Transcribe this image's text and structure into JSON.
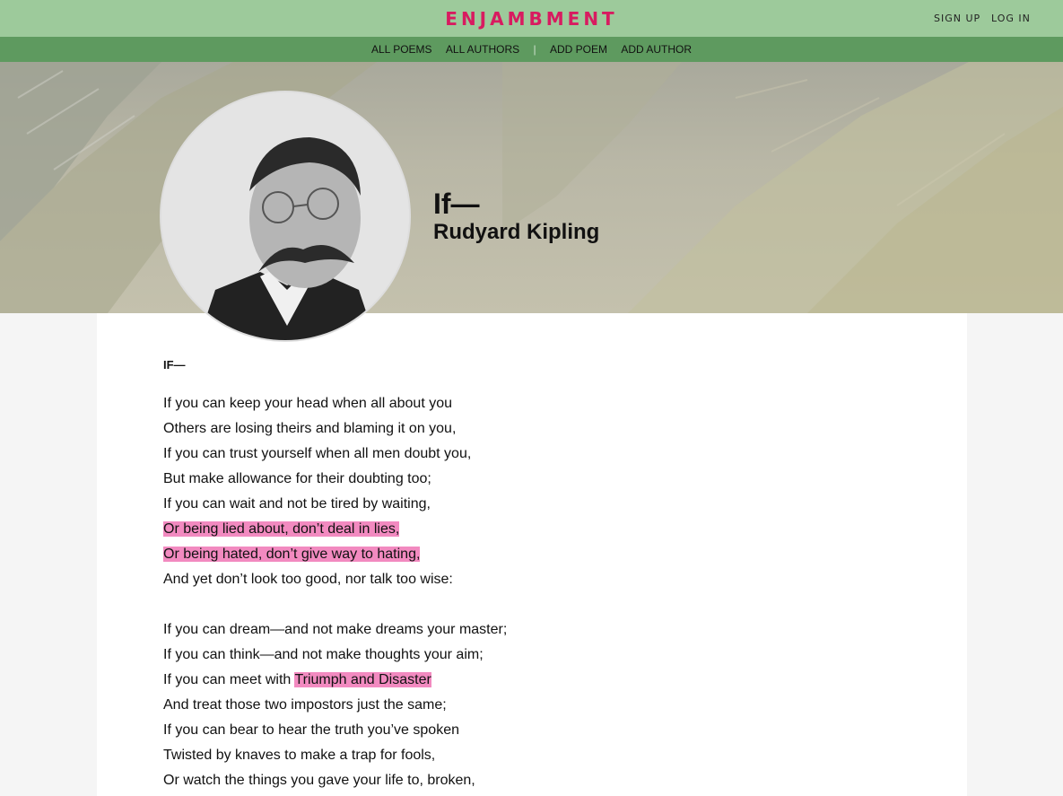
{
  "header": {
    "logo": "ENJAMBMENT",
    "sign_up": "SIGN UP",
    "log_in": "LOG IN"
  },
  "nav": {
    "all_poems": "ALL POEMS",
    "all_authors": "ALL AUTHORS",
    "separator": "|",
    "add_poem": "ADD POEM",
    "add_author": "ADD AUTHOR"
  },
  "poem": {
    "title": "If—",
    "author": "Rudyard Kipling",
    "heading": "IF—",
    "lines": [
      {
        "pre": "If you can keep your head when all about you",
        "hl": "",
        "post": ""
      },
      {
        "pre": "Others are losing theirs and blaming it on you,",
        "hl": "",
        "post": ""
      },
      {
        "pre": "If you can trust yourself when all men doubt you,",
        "hl": "",
        "post": ""
      },
      {
        "pre": "But make allowance for their doubting too;",
        "hl": "",
        "post": ""
      },
      {
        "pre": "If you can wait and not be tired by waiting,",
        "hl": "",
        "post": ""
      },
      {
        "pre": "",
        "hl": "Or being lied about, don’t deal in lies,",
        "post": ""
      },
      {
        "pre": "",
        "hl": "Or being hated, don’t give way to hating,",
        "post": ""
      },
      {
        "pre": "And yet don’t look too good, nor talk too wise:",
        "hl": "",
        "post": ""
      },
      {
        "pre": "",
        "hl": "",
        "post": ""
      },
      {
        "pre": "If you can dream—and not make dreams your master;",
        "hl": "",
        "post": ""
      },
      {
        "pre": "If you can think—and not make thoughts your aim;",
        "hl": "",
        "post": ""
      },
      {
        "pre": "If you can meet with ",
        "hl": "Triumph and Disaster",
        "post": ""
      },
      {
        "pre": "And treat those two impostors just the same;",
        "hl": "",
        "post": ""
      },
      {
        "pre": "If you can bear to hear the truth you’ve spoken",
        "hl": "",
        "post": ""
      },
      {
        "pre": "Twisted by knaves to make a trap for fools,",
        "hl": "",
        "post": ""
      },
      {
        "pre": "Or watch the things you gave your life to, broken,",
        "hl": "",
        "post": ""
      }
    ]
  },
  "colors": {
    "topbar": "#9dca9b",
    "navbar": "#5e9a5f",
    "logo": "#d81b60",
    "highlight": "#f28ac0"
  },
  "icons": {
    "portrait": "author-portrait"
  }
}
